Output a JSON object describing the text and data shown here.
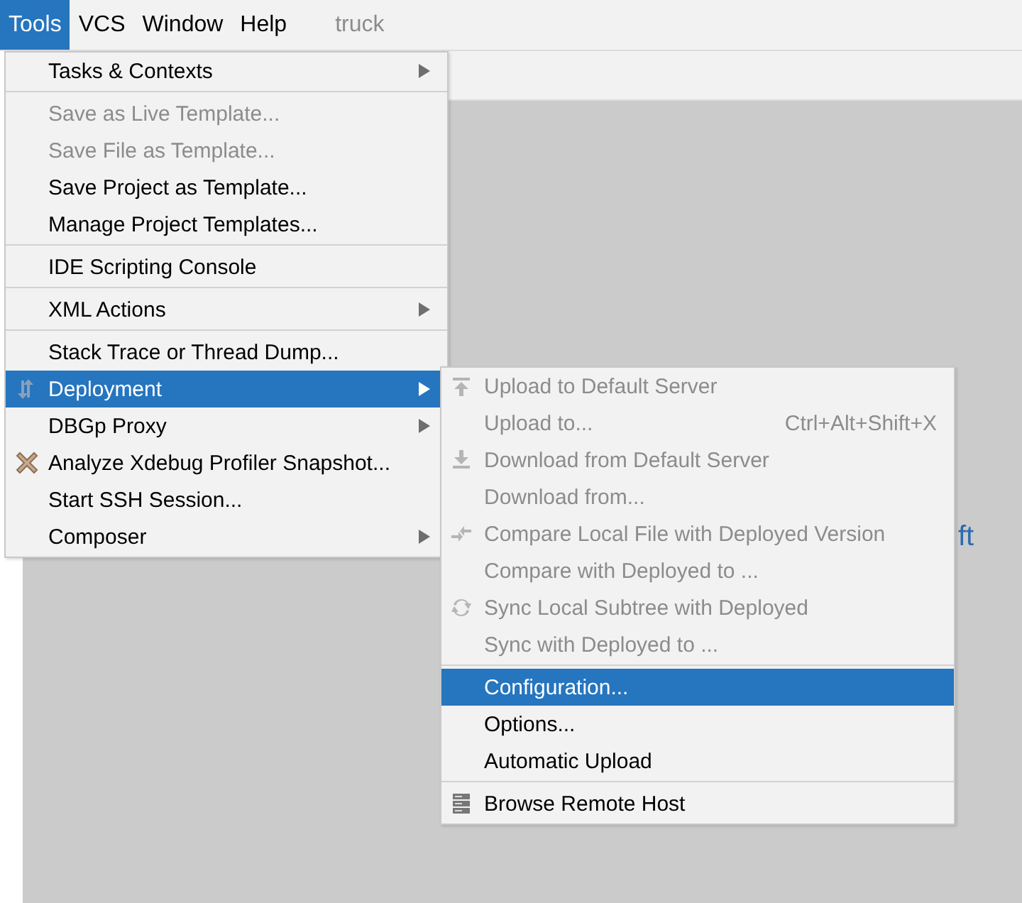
{
  "menu_bar": [
    {
      "label": "Tools",
      "selected": true
    },
    {
      "label": "VCS",
      "selected": false
    },
    {
      "label": "Window",
      "selected": false
    },
    {
      "label": "Help",
      "selected": false
    }
  ],
  "project_name": "truck",
  "editor": {
    "partial_text": "ft"
  },
  "tools_menu": [
    {
      "kind": "item",
      "label": "Tasks & Contexts",
      "disabled": false,
      "selected": false,
      "submenu": true
    },
    {
      "kind": "separator"
    },
    {
      "kind": "item",
      "label": "Save as Live Template...",
      "disabled": true,
      "selected": false,
      "submenu": false
    },
    {
      "kind": "item",
      "label": "Save File as Template...",
      "disabled": true,
      "selected": false,
      "submenu": false
    },
    {
      "kind": "item",
      "label": "Save Project as Template...",
      "disabled": false,
      "selected": false,
      "submenu": false
    },
    {
      "kind": "item",
      "label": "Manage Project Templates...",
      "disabled": false,
      "selected": false,
      "submenu": false
    },
    {
      "kind": "separator"
    },
    {
      "kind": "item",
      "label": "IDE Scripting Console",
      "disabled": false,
      "selected": false,
      "submenu": false
    },
    {
      "kind": "separator"
    },
    {
      "kind": "item",
      "label": "XML Actions",
      "disabled": false,
      "selected": false,
      "submenu": true
    },
    {
      "kind": "separator"
    },
    {
      "kind": "item",
      "label": "Stack Trace or Thread Dump...",
      "disabled": false,
      "selected": false,
      "submenu": false
    },
    {
      "kind": "item",
      "label": "Deployment",
      "disabled": false,
      "selected": true,
      "submenu": true
    },
    {
      "kind": "item",
      "label": "DBGp Proxy",
      "disabled": false,
      "selected": false,
      "submenu": true
    },
    {
      "kind": "item",
      "label": "Analyze Xdebug Profiler Snapshot...",
      "disabled": false,
      "selected": false,
      "submenu": false
    },
    {
      "kind": "item",
      "label": "Start SSH Session...",
      "disabled": false,
      "selected": false,
      "submenu": false
    },
    {
      "kind": "item",
      "label": "Composer",
      "disabled": false,
      "selected": false,
      "submenu": true
    }
  ],
  "deployment_menu": [
    {
      "kind": "item",
      "label": "Upload to Default Server",
      "disabled": true,
      "selected": false,
      "submenu": false
    },
    {
      "kind": "item",
      "label": "Upload to...",
      "disabled": true,
      "selected": false,
      "submenu": false,
      "shortcut": "Ctrl+Alt+Shift+X"
    },
    {
      "kind": "item",
      "label": "Download from Default Server",
      "disabled": true,
      "selected": false,
      "submenu": false
    },
    {
      "kind": "item",
      "label": "Download from...",
      "disabled": true,
      "selected": false,
      "submenu": false
    },
    {
      "kind": "item",
      "label": "Compare Local File with Deployed Version",
      "disabled": true,
      "selected": false,
      "submenu": false
    },
    {
      "kind": "item",
      "label": "Compare with Deployed to ...",
      "disabled": true,
      "selected": false,
      "submenu": false
    },
    {
      "kind": "item",
      "label": "Sync Local Subtree with Deployed",
      "disabled": true,
      "selected": false,
      "submenu": false
    },
    {
      "kind": "item",
      "label": "Sync with Deployed to ...",
      "disabled": true,
      "selected": false,
      "submenu": false
    },
    {
      "kind": "separator"
    },
    {
      "kind": "item",
      "label": "Configuration...",
      "disabled": false,
      "selected": true,
      "submenu": false
    },
    {
      "kind": "item",
      "label": "Options...",
      "disabled": false,
      "selected": false,
      "submenu": false
    },
    {
      "kind": "item",
      "label": "Automatic Upload",
      "disabled": false,
      "selected": false,
      "submenu": false
    },
    {
      "kind": "separator"
    },
    {
      "kind": "item",
      "label": "Browse Remote Host",
      "disabled": false,
      "selected": false,
      "submenu": false
    }
  ]
}
